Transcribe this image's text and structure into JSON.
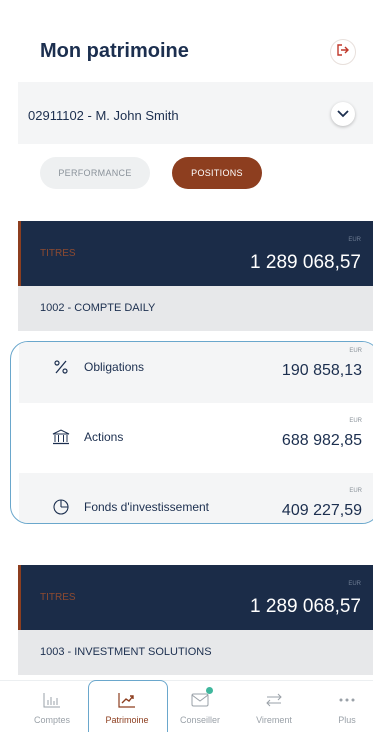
{
  "header": {
    "title": "Mon patrimoine",
    "logout_icon": "logout-icon"
  },
  "account": {
    "label": "02911102 - M. John Smith",
    "dropdown_icon": "chevron-down-icon"
  },
  "tabs": [
    {
      "label": "PERFORMANCE",
      "active": false
    },
    {
      "label": "POSITIONS",
      "active": true
    }
  ],
  "sections": [
    {
      "label": "TITRES",
      "currency": "EUR",
      "amount": "1 289 068,57",
      "account_name": "1002 - COMPTE DAILY",
      "positions": [
        {
          "name": "Obligations",
          "icon": "percent-icon",
          "currency": "EUR",
          "amount": "190 858,13"
        },
        {
          "name": "Actions",
          "icon": "bank-icon",
          "currency": "EUR",
          "amount": "688 982,85"
        },
        {
          "name": "Fonds d'investissement",
          "icon": "pie-chart-icon",
          "currency": "EUR",
          "amount": "409 227,59"
        }
      ]
    },
    {
      "label": "TITRES",
      "currency": "EUR",
      "amount": "1 289 068,57",
      "account_name": "1003 - INVESTMENT SOLUTIONS"
    }
  ],
  "nav": [
    {
      "label": "Comptes",
      "icon": "bar-chart-icon",
      "active": false
    },
    {
      "label": "Patrimoine",
      "icon": "trend-chart-icon",
      "active": true
    },
    {
      "label": "Conseiller",
      "icon": "mail-icon",
      "active": false
    },
    {
      "label": "Virement",
      "icon": "transfer-icon",
      "active": false
    },
    {
      "label": "Plus",
      "icon": "more-icon",
      "active": false
    }
  ],
  "colors": {
    "navy": "#1b2c48",
    "accent": "#8d3e1f",
    "highlight": "#6aa7cc",
    "badge": "#3fb79d"
  }
}
